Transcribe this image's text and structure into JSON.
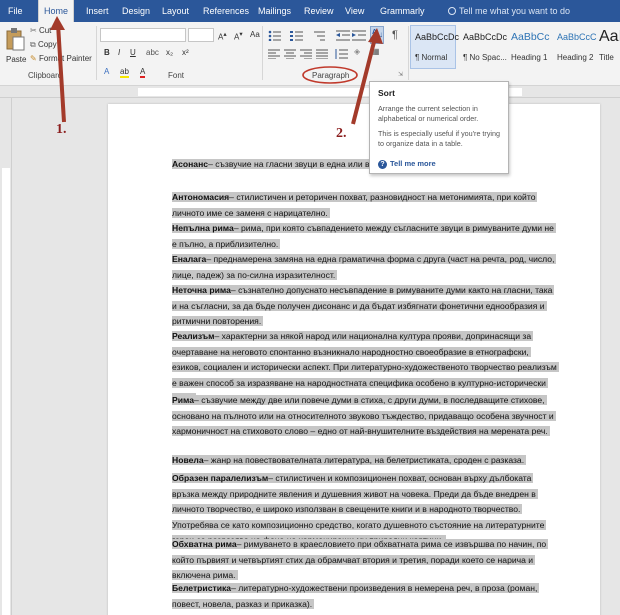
{
  "tabs": [
    "File",
    "Home",
    "Insert",
    "Design",
    "Layout",
    "References",
    "Mailings",
    "Review",
    "View",
    "Grammarly"
  ],
  "active_tab": "Home",
  "tell_me": "Tell me what you want to do",
  "ribbon": {
    "clipboard": {
      "paste": "Paste",
      "cut": "Cut",
      "copy": "Copy",
      "format_painter": "Format Painter",
      "label": "Clipboard"
    },
    "font": {
      "label": "Font"
    },
    "paragraph": {
      "label": "Paragraph"
    },
    "styles": [
      {
        "sample": "AaBbCcDc",
        "name": "¶ Normal"
      },
      {
        "sample": "AaBbCcDc",
        "name": "¶ No Spac..."
      },
      {
        "sample": "AaBbCc",
        "name": "Heading 1"
      },
      {
        "sample": "AaBbCcC",
        "name": "Heading 2"
      },
      {
        "sample": "AaB",
        "name": "Title"
      }
    ]
  },
  "tooltip": {
    "title": "Sort",
    "line1": "Arrange the current selection in alphabetical or numerical order.",
    "line2": "This is especially useful if you're trying to organize data in a table.",
    "link": "Tell me more"
  },
  "annotations": {
    "one": "1.",
    "two": "2."
  },
  "document": {
    "paragraphs": [
      {
        "term": "Асонанс",
        "text": "– съзвучие на гласни звуци в една или в н... дисонанс."
      },
      {
        "term": "Антономасия",
        "text": "– стилистичен и реторичен похват, разновидност на метонимията, при който личното име се заменя с нарицателно."
      },
      {
        "term": "Непълна рима",
        "text": "– рима, при която съвпадението между съгласните звуци в римуваните думи не е пълно, а приблизително."
      },
      {
        "term": "Еналага",
        "text": "– преднамерена замяна на една граматична форма с друга (част на речта, род, число, лице, падеж) за по-силна изразителност."
      },
      {
        "term": "Неточна рима",
        "text": "– съзнателно допуснато несъвпадение в римуваните думи както на гласни, така и на съгласни, за да бъде получен дисонанс и да бъдат избягнати фонетични еднообразия и ритмични повторения."
      },
      {
        "term": "Реализъм",
        "text": "– характерни за някой народ или национална култура прояви, допринасящи за очертаване на неговото спонтанно възникнало народностно своеобразие в етнографски, езиков, социален и исторически аспект. При литературно-художественото творчество реализъм е важен способ за изразяване на народностната специфика особено в културно-исторически план."
      },
      {
        "term": "Рима",
        "text": "– съзвучие между две или повече думи в стиха, с други думи, в последващите стихове, основано на пълното или на относителното звуково тъждество, придаващо особена звучност и хармоничност на стиховото слово – едно от най-внушителните въздействия на мерената реч."
      },
      {
        "term": "Новела",
        "text": "– жанр на повествователната литература, на белетристиката, сроден с разказа."
      },
      {
        "term": "Образен паралелизъм",
        "text": "– стилистичен и композиционен похват, основан върху дълбоката връзка между природните явления и душевния живот на човека. Преди да бъде внедрен в личното творчество, е широко използван в свещените книги и в народното творчество. Употребява се като композиционно средство, когато душевното състояние на литературните герои се разразява на фона на хармониращи му природни картини."
      },
      {
        "term": "Обхватна рима",
        "text": "– римуването в краесловието при обхватната рима се извършва по начин, по който първият и четвъртият стих да обрамчват втория и третия, поради което се нарича и включена рима."
      },
      {
        "term": "Белетристика",
        "text": "– литературно-художествени произведения в немерена реч, в проза (роман, повест, новела, разказ и приказка)."
      }
    ]
  }
}
